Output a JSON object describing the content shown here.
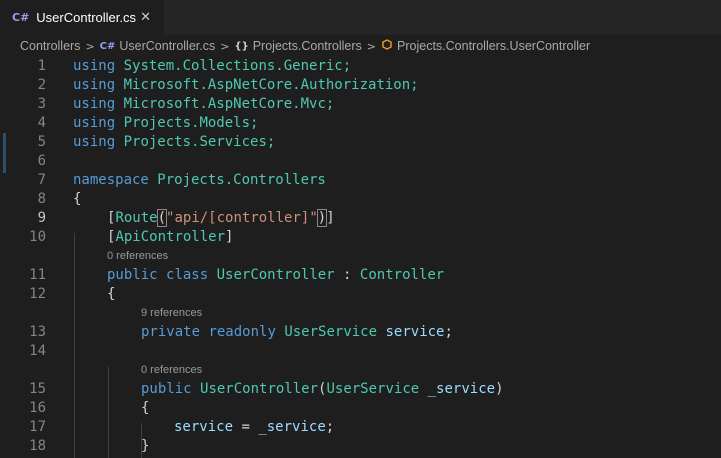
{
  "tab": {
    "icon": "C#",
    "label": "UserController.cs",
    "close_icon": "✕"
  },
  "breadcrumb": {
    "segments": [
      "Controllers",
      "UserController.cs",
      "Projects.Controllers",
      "Projects.Controllers.UserController"
    ],
    "icons": [
      "C#",
      "{}"
    ]
  },
  "editor": {
    "line_numbers": [
      "1",
      "2",
      "3",
      "4",
      "5",
      "6",
      "7",
      "8",
      "9",
      "10",
      "11",
      "12",
      "13",
      "14",
      "15",
      "16",
      "17",
      "18"
    ],
    "lines": {
      "l1": {
        "kw": "using",
        "rest": " System.Collections.Generic;"
      },
      "l2": {
        "kw": "using",
        "rest": " Microsoft.AspNetCore.Authorization;"
      },
      "l3": {
        "kw": "using",
        "rest": " Microsoft.AspNetCore.Mvc;"
      },
      "l4": {
        "kw": "using",
        "rest": " Projects.Models;"
      },
      "l5": {
        "kw": "using",
        "rest": " Projects.Services;"
      },
      "l7": {
        "kw": "namespace",
        "rest": " Projects.Controllers"
      },
      "l8": "{",
      "l9": {
        "open": "[",
        "attr": "Route",
        "paren_open": "(",
        "string": "\"api/[controller]\"",
        "paren_close": ")",
        "close": "]"
      },
      "l10": {
        "open": "[",
        "attr": "ApiController",
        "close": "]"
      },
      "l11": {
        "kw1": "public",
        "kw2": "class",
        "name": "UserController",
        "colon": " : ",
        "base": "Controller"
      },
      "l12": "{",
      "l13": {
        "kw1": "private",
        "kw2": "readonly",
        "type": "UserService",
        "field": "service",
        "end": ";"
      },
      "l15": {
        "kw": "public",
        "name": "UserController",
        "open": "(",
        "type": "UserService",
        "param": "_service",
        "close": ")"
      },
      "l16": "{",
      "l17": {
        "lhs": "service",
        "op": " = ",
        "rhs": "_service",
        "end": ";"
      },
      "l18": "}"
    },
    "codelens": {
      "class": "0 references",
      "field": "9 references",
      "ctor": "0 references"
    }
  }
}
